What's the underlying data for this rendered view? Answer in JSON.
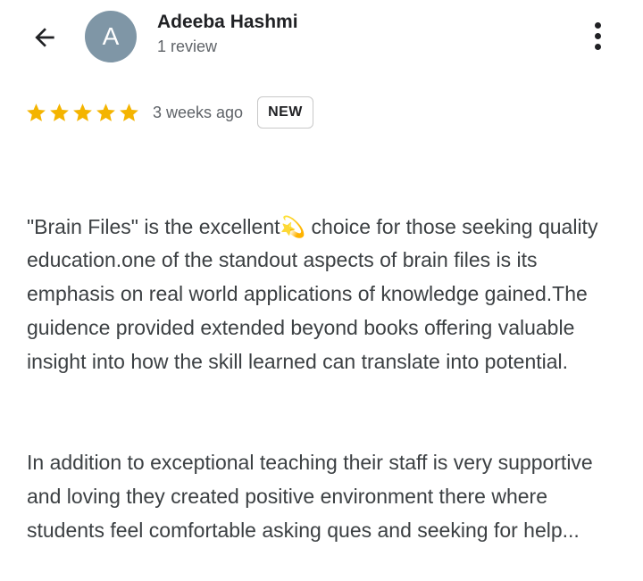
{
  "header": {
    "back_icon": "arrow-back-icon",
    "avatar_letter": "A",
    "avatar_color": "#7f96a6",
    "reviewer_name": "Adeeba Hashmi",
    "reviewer_meta": "1 review",
    "more_icon": "more-vertical-icon"
  },
  "review": {
    "rating": 5,
    "max_rating": 5,
    "star_color": "#f4b400",
    "date": "3 weeks ago",
    "badge": "NEW",
    "paragraph_1": "\"Brain Files\" is the excellent💫 choice for those seeking quality education.one of the standout aspects of brain files is its emphasis on real world applications of knowledge gained.The guidence provided extended beyond books offering valuable insight into how the skill learned can translate into potential.",
    "paragraph_2": "In addition to exceptional teaching their staff is very supportive and loving they created positive environment there where students feel comfortable asking ques and seeking for help..."
  }
}
